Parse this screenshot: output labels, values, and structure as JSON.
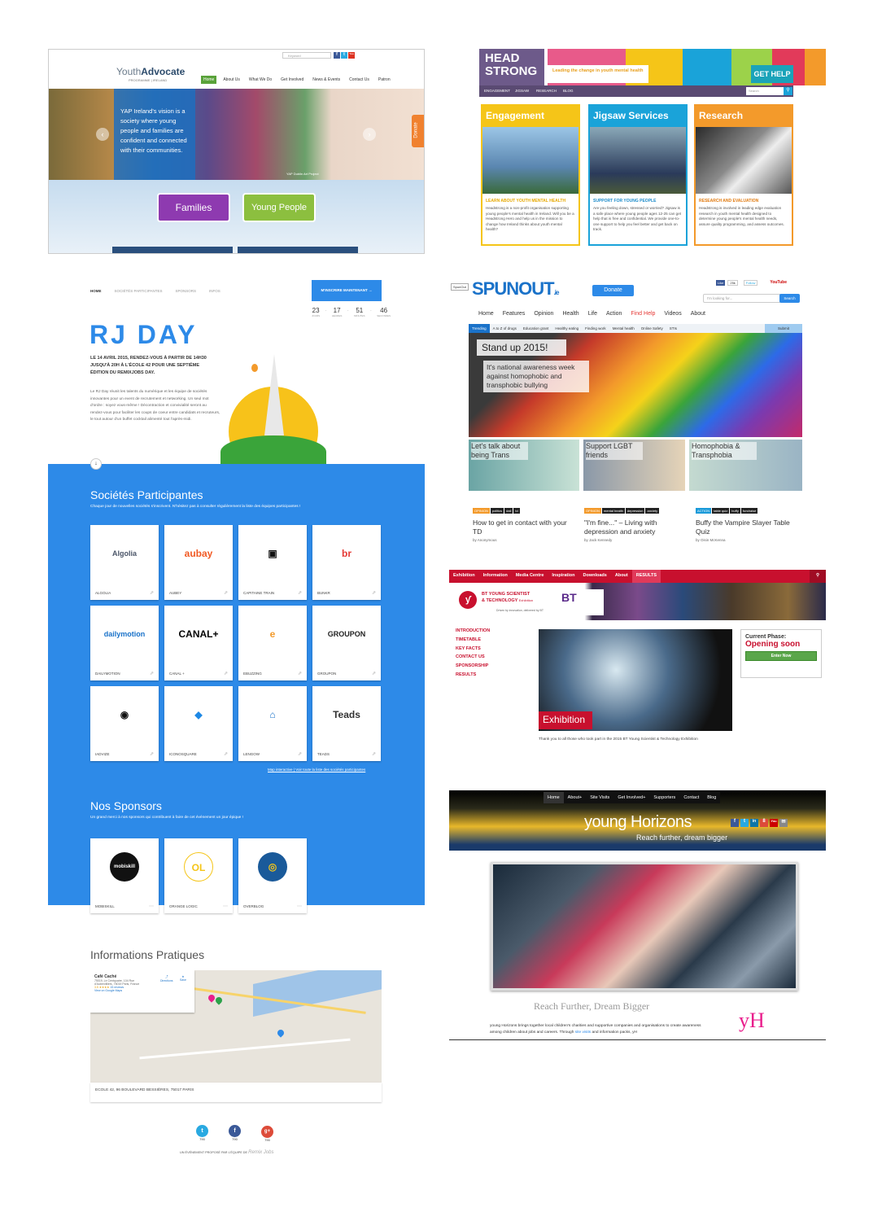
{
  "yap": {
    "logo_light": "Youth",
    "logo_bold": "Advocate",
    "logo_sub": "PROGRAMME | IRELAND",
    "search_placeholder": "Keyword",
    "social": [
      "f",
      "t",
      "You"
    ],
    "nav": [
      "Home",
      "About Us",
      "What We Do",
      "Get Involved",
      "News & Events",
      "Contact Us",
      "Patron"
    ],
    "vision": "YAP Ireland's vision is a society where young people and families are confident and connected with their communities.",
    "caption": "YAP Dublin Art Project",
    "donate": "Donate",
    "btn_families": "Families",
    "btn_young": "Young People"
  },
  "hs": {
    "logo": [
      "HEAD",
      "STRONG"
    ],
    "tagline": "Leading the change in youth mental health",
    "get_help": "GET HELP",
    "nav": [
      "ENGAGEMENT",
      "JIGSAW",
      "RESEARCH",
      "BLOG"
    ],
    "search_placeholder": "Search",
    "cols": [
      {
        "title": "Engagement",
        "sub": "LEARN ABOUT YOUTH MENTAL HEALTH",
        "text": "Headstrong is a non-profit organisation supporting young people's mental health in Ireland. Will you be a Headstrong Hero and help us in the mission to change how Ireland thinks about youth mental health?",
        "color": "#f5c518"
      },
      {
        "title": "Jigsaw Services",
        "sub": "SUPPORT FOR YOUNG PEOPLE",
        "text": "Are you feeling down, stressed or worried? Jigsaw is a safe place where young people ages 12-25 can get help that is free and confidential. We provide one-to-one support to help you feel better and get back on track.",
        "color": "#1aa3d9"
      },
      {
        "title": "Research",
        "sub": "RESEARCH AND EVALUATION",
        "text": "Headstrong is involved in leading edge evaluation research in youth mental health designed to determine young people's mental health needs, assure quality programming, and assess outcomes.",
        "color": "#f39a2b"
      }
    ]
  },
  "rj": {
    "nav": [
      "HOME",
      "SOCIÉTÉS PARTICIPANTES",
      "SPONSORS",
      "INFOS"
    ],
    "cta": "M'INSCRIRE MAINTENANT",
    "countdown": [
      {
        "v": "23",
        "l": "JOURS"
      },
      {
        "v": "17",
        "l": "HEURES"
      },
      {
        "v": "51",
        "l": "MINUTES"
      },
      {
        "v": "46",
        "l": "SECONDES"
      }
    ],
    "title": "RJ DAY",
    "lead": "LE 14 AVRIL 2015, RENDEZ-VOUS À PARTIR DE 14H30 JUSQU'À 20H À L'ÉCOLE 42 POUR UNE SEPTIÈME ÉDITION DU REMIXJOBS DAY.",
    "body": "Le RJ Day réunit les talents du numérique et les équipe de sociétés innovantes pour un event de recrutement et networking. Un seul mot d'ordre : soyez vous-même ! Décontraction et convivialité seront au rendez-vous pour faciliter les coups de coeur entre candidats et recruteurs, le tout autour d'un buffet cocktail alimenté tout l'après-midi.",
    "companies_title": "Sociétés Participantes",
    "companies_sub": "Chaque jour de nouvelles sociétés s'inscrivent. N'hésitez pas à consulter régulièrement la liste des équipes participantes !",
    "companies": [
      {
        "logo": "Algolia",
        "label": "ALGOLIA",
        "color": "#4a5568"
      },
      {
        "logo": "aubay",
        "label": "AUBEY",
        "color": "#f15a24"
      },
      {
        "logo": "▣",
        "label": "CAPITAINE TRAIN",
        "color": "#111"
      },
      {
        "logo": "br",
        "label": "BUNKR",
        "color": "#e53935"
      },
      {
        "logo": "dailymotion",
        "label": "DAILYMOTION",
        "color": "#1a72c9"
      },
      {
        "logo": "CANAL+",
        "label": "CANAL +",
        "color": "#000"
      },
      {
        "logo": "e",
        "label": "EBUZZING",
        "color": "#f39a2b"
      },
      {
        "logo": "GROUPON",
        "label": "GROUPON",
        "color": "#222"
      },
      {
        "logo": "◉",
        "label": "IADVIZE",
        "color": "#111"
      },
      {
        "logo": "◆",
        "label": "ICONOSQUARE",
        "color": "#1e88e5"
      },
      {
        "logo": "⌂",
        "label": "LENGOW",
        "color": "#1a72c9"
      },
      {
        "logo": "Teads",
        "label": "TEADS",
        "color": "#333"
      }
    ],
    "map_link": "Map interactive",
    "list_link": "Voir toute la liste des sociétés participantes",
    "sponsors_title": "Nos Sponsors",
    "sponsors_sub": "Un grand merci à nos sponsors qui contribuent à faire de cet événement un jour épique !",
    "sponsors": [
      {
        "logo": "mobiskill",
        "label": "MOBISKILL"
      },
      {
        "logo": "OL",
        "label": "ORANGE LOGIC"
      },
      {
        "logo": "◎",
        "label": "OVERBLOG"
      }
    ],
    "info_title": "Informations Pratiques",
    "map_place": "Café Caché",
    "map_addr": "75019, Le Centquatre, 104 Rue d'Aubervilliers, 75019 Paris, France",
    "map_rating": "3.5 ★★★★",
    "map_reviews": "15 reviews",
    "map_view": "View on Google Maps",
    "map_dir": "Directions",
    "map_save": "Save",
    "address": "ECOLE 42, 96 BOULEVARD BESSIÈRES, 75017 PARIS",
    "shares": [
      {
        "icon": "t",
        "count": "790",
        "color": "#29a9e1"
      },
      {
        "icon": "f",
        "count": "790",
        "color": "#3b5998"
      },
      {
        "icon": "g+",
        "count": "790",
        "color": "#dd4b39"
      }
    ],
    "footer": "UN ÉVÉNEMENT PROPOSÉ PAR L'ÉQUIPE DE",
    "footer_brand": "Remix Jobs"
  },
  "sp": {
    "badge": "SpunOut",
    "logo": "SPUNOUT",
    "logo_tld": ".ie",
    "donate": "Donate",
    "fb_like": "Like",
    "fb_count": "25k",
    "tw_follow": "Follow",
    "youtube": "YouTube",
    "search_placeholder": "I'm looking for...",
    "search_btn": "Search",
    "nav": [
      "Home",
      "Features",
      "Opinion",
      "Health",
      "Life",
      "Action",
      "Find Help",
      "Videos",
      "About"
    ],
    "sub": [
      "Trending",
      "A to Z of drugs",
      "Education grant",
      "Healthy eating",
      "Finding work",
      "Mental health",
      "Online Safety",
      "STIs",
      "Submit"
    ],
    "hero_title": "Stand up 2015!",
    "hero_text": "It's national awareness week against homophobic and transphobic bullying",
    "thumbs": [
      "Let's talk about being Trans",
      "Support LGBT friends",
      "Homophobia & Transphobia"
    ],
    "articles": [
      {
        "tags": [
          "OPINION",
          "politics",
          "dail",
          "td"
        ],
        "title": "How to get in contact with your TD",
        "by": "by Anonymous"
      },
      {
        "tags": [
          "OPINION",
          "mental health",
          "depression",
          "anxiety"
        ],
        "title": "\"I'm fine...\" – Living with depression and anxiety",
        "by": "by Jack Kennedy"
      },
      {
        "tags": [
          "ACTION",
          "table quiz",
          "buffy",
          "fundraise"
        ],
        "title": "Buffy the Vampire Slayer Table Quiz",
        "by": "by Oisin McKenna"
      }
    ]
  },
  "bt": {
    "nav": [
      "Exhibition",
      "Information",
      "Media Centre",
      "Inspiration",
      "Downloads",
      "About",
      "RESULTS"
    ],
    "logo_line1": "BT YOUNG SCIENTIST",
    "logo_line2": "& TECHNOLOGY",
    "logo_line3": "Exhibition",
    "bt": "BT",
    "driven": "Driven by innovation, delivered by BT",
    "side": [
      "INTRODUCTION",
      "TIMETABLE",
      "KEY FACTS",
      "CONTACT US",
      "SPONSORSHIP",
      "RESULTS"
    ],
    "label": "Exhibition",
    "caption": "Thank you to all those who took part in the 2015 BT Young Scientist & Technology Exhibition",
    "phase_label": "Current Phase:",
    "phase_value": "Opening soon",
    "enter": "Enter Now"
  },
  "yh": {
    "nav": [
      "Home",
      "About+",
      "Site Visits",
      "Get Involved+",
      "Supporters",
      "Contact",
      "Blog"
    ],
    "title": "young Horizons",
    "tagline": "Reach further, dream bigger",
    "social": [
      "f",
      "t",
      "in",
      "8",
      "You",
      "✉"
    ],
    "headline": "Reach Further, Dream Bigger",
    "body_a": "young Horizons brings together local children's charities and supportive companies and organisations to create awareness among children about jobs and careers. Through ",
    "body_link": "site visits",
    "body_b": " and information packs, yH",
    "mark": "yH"
  }
}
